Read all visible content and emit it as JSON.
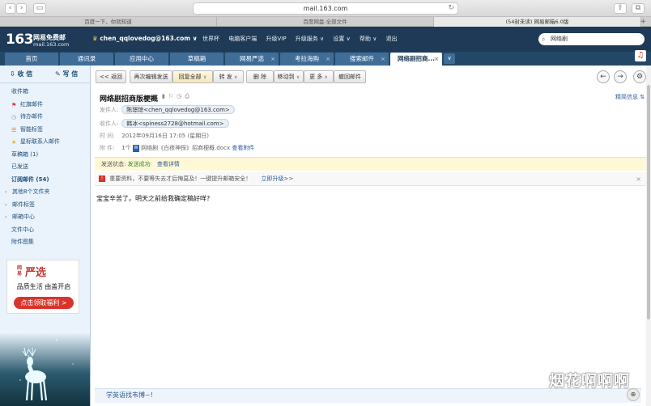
{
  "browser": {
    "url": "mail.163.com",
    "tabs": [
      "百度一下，你就知道",
      "百度网盘-全部文件",
      "(54封未读) 网易邮箱6.0版"
    ]
  },
  "header": {
    "logo_num": "163",
    "logo_title": "网易免费邮",
    "logo_domain": "mail.163.com",
    "user": "chen_qqlovedog@163.com ∨",
    "links": [
      "世界杯",
      "电脑客户端",
      "升级VIP",
      "升级服务 ∨",
      "设置 ∨",
      "帮助 ∨",
      "退出"
    ],
    "search_text": "网络剧"
  },
  "nav": {
    "tabs": [
      "首页",
      "通讯录",
      "应用中心",
      "草稿箱",
      "网易严选",
      "考拉海购",
      "搜索邮件",
      "网络剧招商..."
    ]
  },
  "sidebar": {
    "receive": "收 信",
    "compose": "写 信",
    "items": [
      {
        "label": "收件箱",
        "icon": ""
      },
      {
        "label": "红旗邮件",
        "icon": "flag-icon"
      },
      {
        "label": "待办邮件",
        "icon": "clock-icon"
      },
      {
        "label": "智能标签",
        "icon": "tag-icon"
      },
      {
        "label": "星标联系人邮件",
        "icon": "star-icon"
      },
      {
        "label": "草稿箱 (1)",
        "icon": ""
      },
      {
        "label": "已发送",
        "icon": ""
      },
      {
        "label": "订阅邮件 (54)",
        "icon": ""
      },
      {
        "label": "其他8个文件夹",
        "icon": "arrow"
      },
      {
        "label": "邮件标签",
        "icon": "arrow"
      },
      {
        "label": "邮箱中心",
        "icon": "arrow"
      },
      {
        "label": "文件中心",
        "icon": ""
      },
      {
        "label": "附件图集",
        "icon": ""
      }
    ],
    "ad": {
      "brand_small": "网易",
      "brand": "严选",
      "slogan": "品质生活 由盖开启",
      "cta": "点击领取福利 >"
    }
  },
  "toolbar": {
    "back": "<< 返回",
    "resend": "再次编辑发送",
    "reply_all": "回复全部",
    "forward": "转 发",
    "delete": "删 除",
    "move": "移动到",
    "more": "更 多",
    "recall": "撤回邮件"
  },
  "email": {
    "subject": "网络剧招商版梗概",
    "compact": "精简信息",
    "from_label": "发件人:",
    "from": "陈璟琼<chen_qqlovedog@163.com>",
    "to_label": "收件人:",
    "to": "韩冰<spiness2728@hotmail.com>",
    "time_label": "时 间:",
    "time": "2012年09月16日 17:05 (星期日)",
    "attach_label": "附 件:",
    "attach_count": "1个",
    "attach_name": "网络剧《白夜神探》招商梗概.docx",
    "attach_view": "查看附件",
    "status_label": "发送状态:",
    "status_value": "发送成功",
    "status_link": "查看详情",
    "warning": "重要资料，不要等失去才后悔莫及！一键提升邮箱安全！",
    "warning_link": "立即升级>>",
    "body": "宝宝辛苦了。明天之前给我确定稿好咩?"
  },
  "footer": {
    "link": "学英语找韦博~!"
  },
  "watermark": "烟花啊啊啊"
}
